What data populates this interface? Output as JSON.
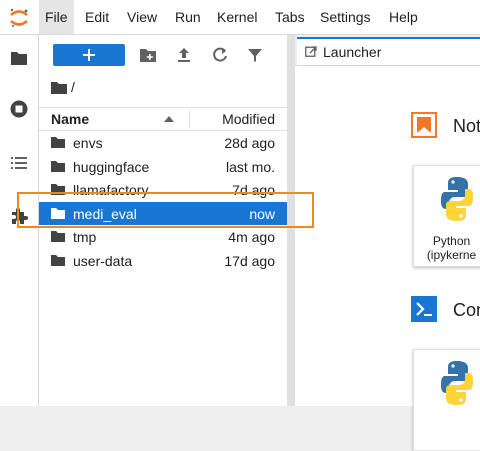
{
  "menubar": {
    "items": [
      "File",
      "Edit",
      "View",
      "Run",
      "Kernel",
      "Tabs",
      "Settings",
      "Help"
    ]
  },
  "filebrowser": {
    "path": "/",
    "columns": {
      "name": "Name",
      "modified": "Modified"
    },
    "files": [
      {
        "name": "envs",
        "modified": "28d ago"
      },
      {
        "name": "huggingface",
        "modified": "last mo."
      },
      {
        "name": "llamafactory",
        "modified": "7d ago"
      },
      {
        "name": "medi_eval",
        "modified": "now"
      },
      {
        "name": "tmp",
        "modified": "4m ago"
      },
      {
        "name": "user-data",
        "modified": "17d ago"
      }
    ]
  },
  "launcher": {
    "tab_label": "Launcher",
    "notebook_section": "Not",
    "console_section": "Con",
    "notebook_kernel_line1": "Python",
    "notebook_kernel_line2": "(ipykerne"
  },
  "colors": {
    "accent": "#1976d2",
    "highlight": "#f0891a",
    "logo": "#f37726"
  }
}
